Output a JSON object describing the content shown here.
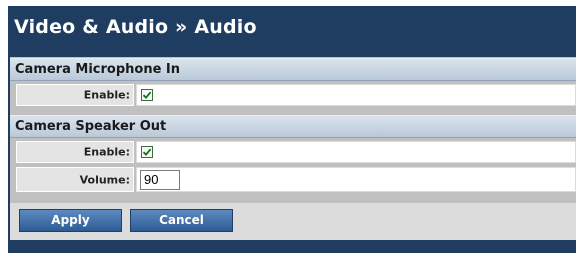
{
  "header": {
    "title": "Video & Audio » Audio"
  },
  "sections": {
    "mic": {
      "title": "Camera Microphone In",
      "enable_label": "Enable:",
      "enable_checked": true
    },
    "speaker": {
      "title": "Camera Speaker Out",
      "enable_label": "Enable:",
      "enable_checked": true,
      "volume_label": "Volume:",
      "volume_value": "90"
    }
  },
  "buttons": {
    "apply": "Apply",
    "cancel": "Cancel"
  },
  "colors": {
    "header_bg": "#1e3d61",
    "section_header_bg": "#c8d4e2",
    "button_bg": "#3d6aa6"
  }
}
